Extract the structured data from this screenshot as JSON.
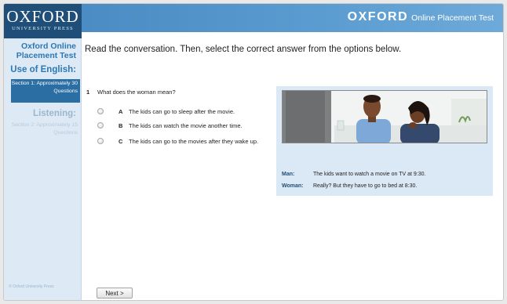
{
  "logo": {
    "main": "OXFORD",
    "sub": "UNIVERSITY PRESS"
  },
  "header": {
    "brand": "OXFORD",
    "title_rest": "Online Placement Test"
  },
  "sidebar": {
    "title": "Oxford Online Placement Test",
    "use_of_english": "Use of English:",
    "section1": "Section 1: Approximately 30 Questions",
    "listening": "Listening:",
    "section2": "Section 2: Approximately 15 Questions",
    "copyright": "© Oxford University Press"
  },
  "instruction": "Read the conversation. Then, select the correct answer from the options below.",
  "question": {
    "number": "1",
    "text": "What does the woman mean?"
  },
  "options": [
    {
      "letter": "A",
      "text": "The kids can go to sleep after the movie."
    },
    {
      "letter": "B",
      "text": "The kids can watch the movie another time."
    },
    {
      "letter": "C",
      "text": "The kids can go to the movies after they wake up."
    }
  ],
  "dialogue": [
    {
      "speaker": "Man:",
      "line": "The kids want to watch a movie on TV at 9:30."
    },
    {
      "speaker": "Woman:",
      "line": "Really? But they have to go to bed at 8:30."
    }
  ],
  "next_button": "Next >",
  "colors": {
    "accent": "#2d78b4",
    "header": "#4a8cc3",
    "logo_bg": "#1f4f78",
    "panel_bg": "#dbe8f5"
  }
}
